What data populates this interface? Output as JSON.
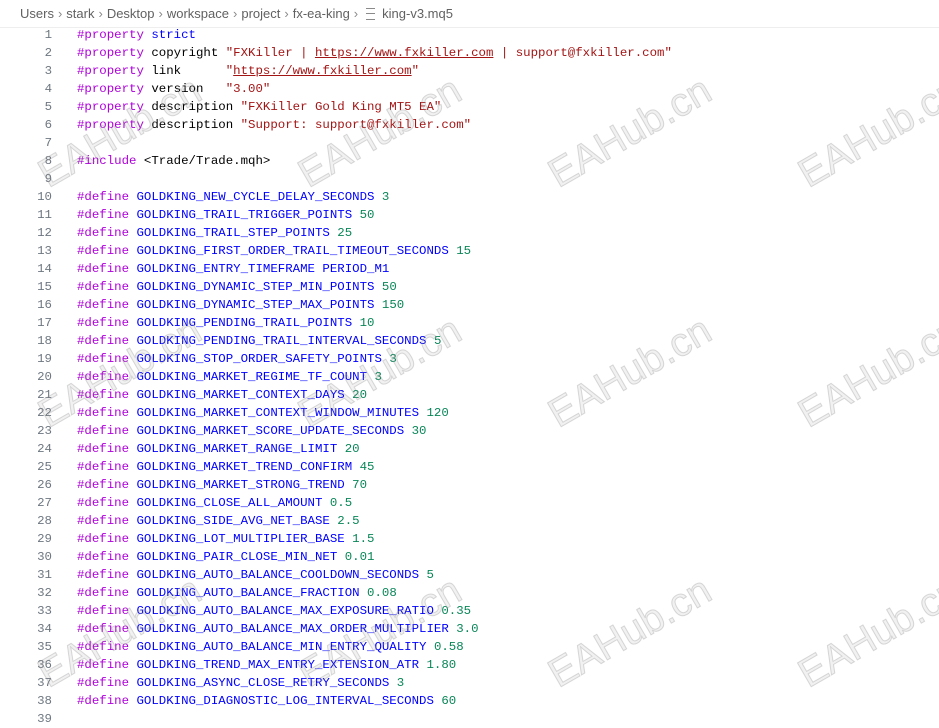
{
  "breadcrumb": [
    "Users",
    "stark",
    "Desktop",
    "workspace",
    "project",
    "fx-ea-king",
    "king-v3.mq5"
  ],
  "watermark": "EAHub.cn",
  "lines": [
    {
      "n": "1",
      "tokens": [
        {
          "t": "kw",
          "v": "#property"
        },
        {
          "t": "plain",
          "v": " "
        },
        {
          "t": "mac",
          "v": "strict"
        }
      ]
    },
    {
      "n": "2",
      "tokens": [
        {
          "t": "kw",
          "v": "#property"
        },
        {
          "t": "plain",
          "v": " copyright "
        },
        {
          "t": "str",
          "v": "\"FXKiller | "
        },
        {
          "t": "url",
          "v": "https://www.fxkiller.com"
        },
        {
          "t": "str",
          "v": " | support@fxkiller.com\""
        }
      ]
    },
    {
      "n": "3",
      "tokens": [
        {
          "t": "kw",
          "v": "#property"
        },
        {
          "t": "plain",
          "v": " link      "
        },
        {
          "t": "str",
          "v": "\""
        },
        {
          "t": "url",
          "v": "https://www.fxkiller.com"
        },
        {
          "t": "str",
          "v": "\""
        }
      ]
    },
    {
      "n": "4",
      "tokens": [
        {
          "t": "kw",
          "v": "#property"
        },
        {
          "t": "plain",
          "v": " version   "
        },
        {
          "t": "str",
          "v": "\"3.00\""
        }
      ]
    },
    {
      "n": "5",
      "tokens": [
        {
          "t": "kw",
          "v": "#property"
        },
        {
          "t": "plain",
          "v": " description "
        },
        {
          "t": "str",
          "v": "\"FXKiller Gold King MT5 EA\""
        }
      ]
    },
    {
      "n": "6",
      "tokens": [
        {
          "t": "kw",
          "v": "#property"
        },
        {
          "t": "plain",
          "v": " description "
        },
        {
          "t": "str",
          "v": "\"Support: support@fxkiller.com\""
        }
      ]
    },
    {
      "n": "7",
      "tokens": []
    },
    {
      "n": "8",
      "tokens": [
        {
          "t": "kw",
          "v": "#include"
        },
        {
          "t": "plain",
          "v": " <Trade/Trade.mqh>"
        }
      ]
    },
    {
      "n": "9",
      "tokens": []
    },
    {
      "n": "10",
      "tokens": [
        {
          "t": "kw",
          "v": "#define"
        },
        {
          "t": "plain",
          "v": " "
        },
        {
          "t": "mac",
          "v": "GOLDKING_NEW_CYCLE_DELAY_SECONDS"
        },
        {
          "t": "plain",
          "v": " "
        },
        {
          "t": "num",
          "v": "3"
        }
      ]
    },
    {
      "n": "11",
      "tokens": [
        {
          "t": "kw",
          "v": "#define"
        },
        {
          "t": "plain",
          "v": " "
        },
        {
          "t": "mac",
          "v": "GOLDKING_TRAIL_TRIGGER_POINTS"
        },
        {
          "t": "plain",
          "v": " "
        },
        {
          "t": "num",
          "v": "50"
        }
      ]
    },
    {
      "n": "12",
      "tokens": [
        {
          "t": "kw",
          "v": "#define"
        },
        {
          "t": "plain",
          "v": " "
        },
        {
          "t": "mac",
          "v": "GOLDKING_TRAIL_STEP_POINTS"
        },
        {
          "t": "plain",
          "v": " "
        },
        {
          "t": "num",
          "v": "25"
        }
      ]
    },
    {
      "n": "13",
      "tokens": [
        {
          "t": "kw",
          "v": "#define"
        },
        {
          "t": "plain",
          "v": " "
        },
        {
          "t": "mac",
          "v": "GOLDKING_FIRST_ORDER_TRAIL_TIMEOUT_SECONDS"
        },
        {
          "t": "plain",
          "v": " "
        },
        {
          "t": "num",
          "v": "15"
        }
      ]
    },
    {
      "n": "14",
      "tokens": [
        {
          "t": "kw",
          "v": "#define"
        },
        {
          "t": "plain",
          "v": " "
        },
        {
          "t": "mac",
          "v": "GOLDKING_ENTRY_TIMEFRAME PERIOD_M1"
        }
      ]
    },
    {
      "n": "15",
      "tokens": [
        {
          "t": "kw",
          "v": "#define"
        },
        {
          "t": "plain",
          "v": " "
        },
        {
          "t": "mac",
          "v": "GOLDKING_DYNAMIC_STEP_MIN_POINTS"
        },
        {
          "t": "plain",
          "v": " "
        },
        {
          "t": "num",
          "v": "50"
        }
      ]
    },
    {
      "n": "16",
      "tokens": [
        {
          "t": "kw",
          "v": "#define"
        },
        {
          "t": "plain",
          "v": " "
        },
        {
          "t": "mac",
          "v": "GOLDKING_DYNAMIC_STEP_MAX_POINTS"
        },
        {
          "t": "plain",
          "v": " "
        },
        {
          "t": "num",
          "v": "150"
        }
      ]
    },
    {
      "n": "17",
      "tokens": [
        {
          "t": "kw",
          "v": "#define"
        },
        {
          "t": "plain",
          "v": " "
        },
        {
          "t": "mac",
          "v": "GOLDKING_PENDING_TRAIL_POINTS"
        },
        {
          "t": "plain",
          "v": " "
        },
        {
          "t": "num",
          "v": "10"
        }
      ]
    },
    {
      "n": "18",
      "tokens": [
        {
          "t": "kw",
          "v": "#define"
        },
        {
          "t": "plain",
          "v": " "
        },
        {
          "t": "mac",
          "v": "GOLDKING_PENDING_TRAIL_INTERVAL_SECONDS"
        },
        {
          "t": "plain",
          "v": " "
        },
        {
          "t": "num",
          "v": "5"
        }
      ]
    },
    {
      "n": "19",
      "tokens": [
        {
          "t": "kw",
          "v": "#define"
        },
        {
          "t": "plain",
          "v": " "
        },
        {
          "t": "mac",
          "v": "GOLDKING_STOP_ORDER_SAFETY_POINTS"
        },
        {
          "t": "plain",
          "v": " "
        },
        {
          "t": "num",
          "v": "3"
        }
      ]
    },
    {
      "n": "20",
      "tokens": [
        {
          "t": "kw",
          "v": "#define"
        },
        {
          "t": "plain",
          "v": " "
        },
        {
          "t": "mac",
          "v": "GOLDKING_MARKET_REGIME_TF_COUNT"
        },
        {
          "t": "plain",
          "v": " "
        },
        {
          "t": "num",
          "v": "3"
        }
      ]
    },
    {
      "n": "21",
      "tokens": [
        {
          "t": "kw",
          "v": "#define"
        },
        {
          "t": "plain",
          "v": " "
        },
        {
          "t": "mac",
          "v": "GOLDKING_MARKET_CONTEXT_DAYS"
        },
        {
          "t": "plain",
          "v": " "
        },
        {
          "t": "num",
          "v": "20"
        }
      ]
    },
    {
      "n": "22",
      "tokens": [
        {
          "t": "kw",
          "v": "#define"
        },
        {
          "t": "plain",
          "v": " "
        },
        {
          "t": "mac",
          "v": "GOLDKING_MARKET_CONTEXT_WINDOW_MINUTES"
        },
        {
          "t": "plain",
          "v": " "
        },
        {
          "t": "num",
          "v": "120"
        }
      ]
    },
    {
      "n": "23",
      "tokens": [
        {
          "t": "kw",
          "v": "#define"
        },
        {
          "t": "plain",
          "v": " "
        },
        {
          "t": "mac",
          "v": "GOLDKING_MARKET_SCORE_UPDATE_SECONDS"
        },
        {
          "t": "plain",
          "v": " "
        },
        {
          "t": "num",
          "v": "30"
        }
      ]
    },
    {
      "n": "24",
      "tokens": [
        {
          "t": "kw",
          "v": "#define"
        },
        {
          "t": "plain",
          "v": " "
        },
        {
          "t": "mac",
          "v": "GOLDKING_MARKET_RANGE_LIMIT"
        },
        {
          "t": "plain",
          "v": " "
        },
        {
          "t": "num",
          "v": "20"
        }
      ]
    },
    {
      "n": "25",
      "tokens": [
        {
          "t": "kw",
          "v": "#define"
        },
        {
          "t": "plain",
          "v": " "
        },
        {
          "t": "mac",
          "v": "GOLDKING_MARKET_TREND_CONFIRM"
        },
        {
          "t": "plain",
          "v": " "
        },
        {
          "t": "num",
          "v": "45"
        }
      ]
    },
    {
      "n": "26",
      "tokens": [
        {
          "t": "kw",
          "v": "#define"
        },
        {
          "t": "plain",
          "v": " "
        },
        {
          "t": "mac",
          "v": "GOLDKING_MARKET_STRONG_TREND"
        },
        {
          "t": "plain",
          "v": " "
        },
        {
          "t": "num",
          "v": "70"
        }
      ]
    },
    {
      "n": "27",
      "tokens": [
        {
          "t": "kw",
          "v": "#define"
        },
        {
          "t": "plain",
          "v": " "
        },
        {
          "t": "mac",
          "v": "GOLDKING_CLOSE_ALL_AMOUNT"
        },
        {
          "t": "plain",
          "v": " "
        },
        {
          "t": "num",
          "v": "0.5"
        }
      ]
    },
    {
      "n": "28",
      "tokens": [
        {
          "t": "kw",
          "v": "#define"
        },
        {
          "t": "plain",
          "v": " "
        },
        {
          "t": "mac",
          "v": "GOLDKING_SIDE_AVG_NET_BASE"
        },
        {
          "t": "plain",
          "v": " "
        },
        {
          "t": "num",
          "v": "2.5"
        }
      ]
    },
    {
      "n": "29",
      "tokens": [
        {
          "t": "kw",
          "v": "#define"
        },
        {
          "t": "plain",
          "v": " "
        },
        {
          "t": "mac",
          "v": "GOLDKING_LOT_MULTIPLIER_BASE"
        },
        {
          "t": "plain",
          "v": " "
        },
        {
          "t": "num",
          "v": "1.5"
        }
      ]
    },
    {
      "n": "30",
      "tokens": [
        {
          "t": "kw",
          "v": "#define"
        },
        {
          "t": "plain",
          "v": " "
        },
        {
          "t": "mac",
          "v": "GOLDKING_PAIR_CLOSE_MIN_NET"
        },
        {
          "t": "plain",
          "v": " "
        },
        {
          "t": "num",
          "v": "0.01"
        }
      ]
    },
    {
      "n": "31",
      "tokens": [
        {
          "t": "kw",
          "v": "#define"
        },
        {
          "t": "plain",
          "v": " "
        },
        {
          "t": "mac",
          "v": "GOLDKING_AUTO_BALANCE_COOLDOWN_SECONDS"
        },
        {
          "t": "plain",
          "v": " "
        },
        {
          "t": "num",
          "v": "5"
        }
      ]
    },
    {
      "n": "32",
      "tokens": [
        {
          "t": "kw",
          "v": "#define"
        },
        {
          "t": "plain",
          "v": " "
        },
        {
          "t": "mac",
          "v": "GOLDKING_AUTO_BALANCE_FRACTION"
        },
        {
          "t": "plain",
          "v": " "
        },
        {
          "t": "num",
          "v": "0.08"
        }
      ]
    },
    {
      "n": "33",
      "tokens": [
        {
          "t": "kw",
          "v": "#define"
        },
        {
          "t": "plain",
          "v": " "
        },
        {
          "t": "mac",
          "v": "GOLDKING_AUTO_BALANCE_MAX_EXPOSURE_RATIO"
        },
        {
          "t": "plain",
          "v": " "
        },
        {
          "t": "num",
          "v": "0.35"
        }
      ]
    },
    {
      "n": "34",
      "tokens": [
        {
          "t": "kw",
          "v": "#define"
        },
        {
          "t": "plain",
          "v": " "
        },
        {
          "t": "mac",
          "v": "GOLDKING_AUTO_BALANCE_MAX_ORDER_MULTIPLIER"
        },
        {
          "t": "plain",
          "v": " "
        },
        {
          "t": "num",
          "v": "3.0"
        }
      ]
    },
    {
      "n": "35",
      "tokens": [
        {
          "t": "kw",
          "v": "#define"
        },
        {
          "t": "plain",
          "v": " "
        },
        {
          "t": "mac",
          "v": "GOLDKING_AUTO_BALANCE_MIN_ENTRY_QUALITY"
        },
        {
          "t": "plain",
          "v": " "
        },
        {
          "t": "num",
          "v": "0.58"
        }
      ]
    },
    {
      "n": "36",
      "tokens": [
        {
          "t": "kw",
          "v": "#define"
        },
        {
          "t": "plain",
          "v": " "
        },
        {
          "t": "mac",
          "v": "GOLDKING_TREND_MAX_ENTRY_EXTENSION_ATR"
        },
        {
          "t": "plain",
          "v": " "
        },
        {
          "t": "num",
          "v": "1.80"
        }
      ]
    },
    {
      "n": "37",
      "tokens": [
        {
          "t": "kw",
          "v": "#define"
        },
        {
          "t": "plain",
          "v": " "
        },
        {
          "t": "mac",
          "v": "GOLDKING_ASYNC_CLOSE_RETRY_SECONDS"
        },
        {
          "t": "plain",
          "v": " "
        },
        {
          "t": "num",
          "v": "3"
        }
      ]
    },
    {
      "n": "38",
      "tokens": [
        {
          "t": "kw",
          "v": "#define"
        },
        {
          "t": "plain",
          "v": " "
        },
        {
          "t": "mac",
          "v": "GOLDKING_DIAGNOSTIC_LOG_INTERVAL_SECONDS"
        },
        {
          "t": "plain",
          "v": " "
        },
        {
          "t": "num",
          "v": "60"
        }
      ]
    },
    {
      "n": "39",
      "tokens": []
    }
  ]
}
